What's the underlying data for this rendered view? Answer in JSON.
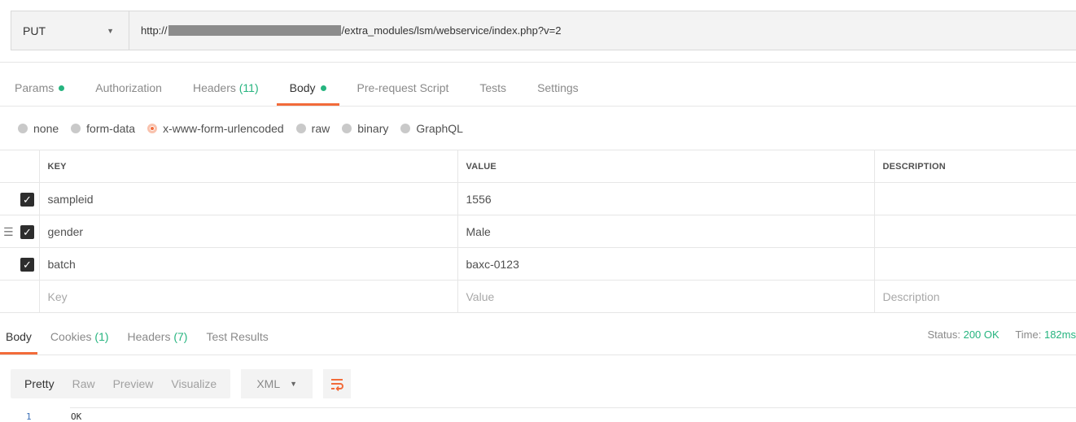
{
  "request": {
    "method": "PUT",
    "url_prefix": "http://",
    "url_suffix": "/extra_modules/lsm/webservice/index.php?v=2"
  },
  "tabs": [
    {
      "label": "Params",
      "dot": true
    },
    {
      "label": "Authorization"
    },
    {
      "label": "Headers",
      "count": "(11)"
    },
    {
      "label": "Body",
      "dot": true,
      "active": true
    },
    {
      "label": "Pre-request Script"
    },
    {
      "label": "Tests"
    },
    {
      "label": "Settings"
    }
  ],
  "body_types": [
    "none",
    "form-data",
    "x-www-form-urlencoded",
    "raw",
    "binary",
    "GraphQL"
  ],
  "selected_body_type": "x-www-form-urlencoded",
  "table": {
    "headers": [
      "KEY",
      "VALUE",
      "DESCRIPTION"
    ],
    "rows": [
      {
        "key": "sampleid",
        "value": "1556",
        "description": "",
        "checked": true
      },
      {
        "key": "gender",
        "value": "Male",
        "description": "",
        "checked": true
      },
      {
        "key": "batch",
        "value": "baxc-0123",
        "description": "",
        "checked": true
      }
    ],
    "placeholders": {
      "key": "Key",
      "value": "Value",
      "description": "Description"
    }
  },
  "response": {
    "tabs": [
      {
        "label": "Body",
        "active": true
      },
      {
        "label": "Cookies",
        "count": "(1)"
      },
      {
        "label": "Headers",
        "count": "(7)"
      },
      {
        "label": "Test Results"
      }
    ],
    "status_label": "Status:",
    "status_value": "200 OK",
    "time_label": "Time:",
    "time_value": "182ms",
    "modes": [
      "Pretty",
      "Raw",
      "Preview",
      "Visualize"
    ],
    "active_mode": "Pretty",
    "format": "XML",
    "line_number": "1",
    "content": "OK"
  },
  "colors": {
    "accent": "#f26b3a",
    "success": "#26b47f"
  }
}
